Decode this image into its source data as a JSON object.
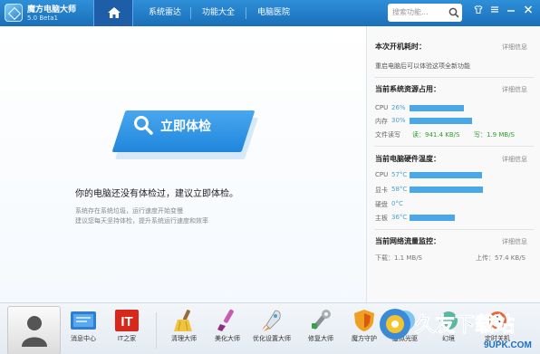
{
  "titlebar": {
    "app_name": "魔方电脑大师",
    "version": "5.0  Beta1",
    "tabs": [
      {
        "label": "系统雷达"
      },
      {
        "label": "功能大全"
      },
      {
        "label": "电脑医院"
      }
    ],
    "search_placeholder": "搜索功能..."
  },
  "main": {
    "check_button_label": "立即体检",
    "message": "你的电脑还没有体检过，建议立即体检。",
    "tips": [
      "系统存在系统垃圾，运行速度开始变慢",
      "建议您每天坚持体检，提升系统运行速度和效率"
    ]
  },
  "right_panel": {
    "details_link": "详细信息",
    "boot": {
      "title": "本次开机耗时：",
      "text": "重启电脑后可以体验这项全新功能"
    },
    "resources": {
      "title": "当前系统资源占用：",
      "cpu_label": "CPU",
      "cpu_value": "26%",
      "cpu_percent": 26,
      "mem_label": "内存",
      "mem_value": "30%",
      "mem_percent": 30,
      "disk_label": "文件读写",
      "disk_read": "读：941.4 KB/S",
      "disk_write": "写：1.9 MB/S"
    },
    "temperature": {
      "title": "当前电脑硬件温度：",
      "items": [
        {
          "label": "CPU",
          "value": "57°C",
          "level": 57
        },
        {
          "label": "显卡",
          "value": "58°C",
          "level": 58
        },
        {
          "label": "硬盘",
          "value": "0°C",
          "level": 0
        },
        {
          "label": "主板",
          "value": "36°C",
          "level": 36
        }
      ]
    },
    "network": {
      "title": "当前网络流量监控：",
      "download": "下载：1.1 MB/S",
      "upload": "上传：57.4 KB/S"
    }
  },
  "bottom": {
    "tools": [
      {
        "label": "消息中心"
      },
      {
        "label": "IT之家"
      },
      {
        "label": "清理大师"
      },
      {
        "label": "美化大师"
      },
      {
        "label": "优化设置大师"
      },
      {
        "label": "修复大师"
      },
      {
        "label": "魔方守护"
      },
      {
        "label": "虚拟光驱"
      },
      {
        "label": "幻境"
      },
      {
        "label": "定时关机"
      }
    ],
    "it_logo_text": "IT"
  },
  "watermark": {
    "text": "久友下载站",
    "url": "9UPK.COM"
  },
  "colors": {
    "accent": "#1f86dc",
    "titlebar": "#2e8fd8",
    "bar": "#4aa7e8",
    "green": "#2ea02e"
  }
}
